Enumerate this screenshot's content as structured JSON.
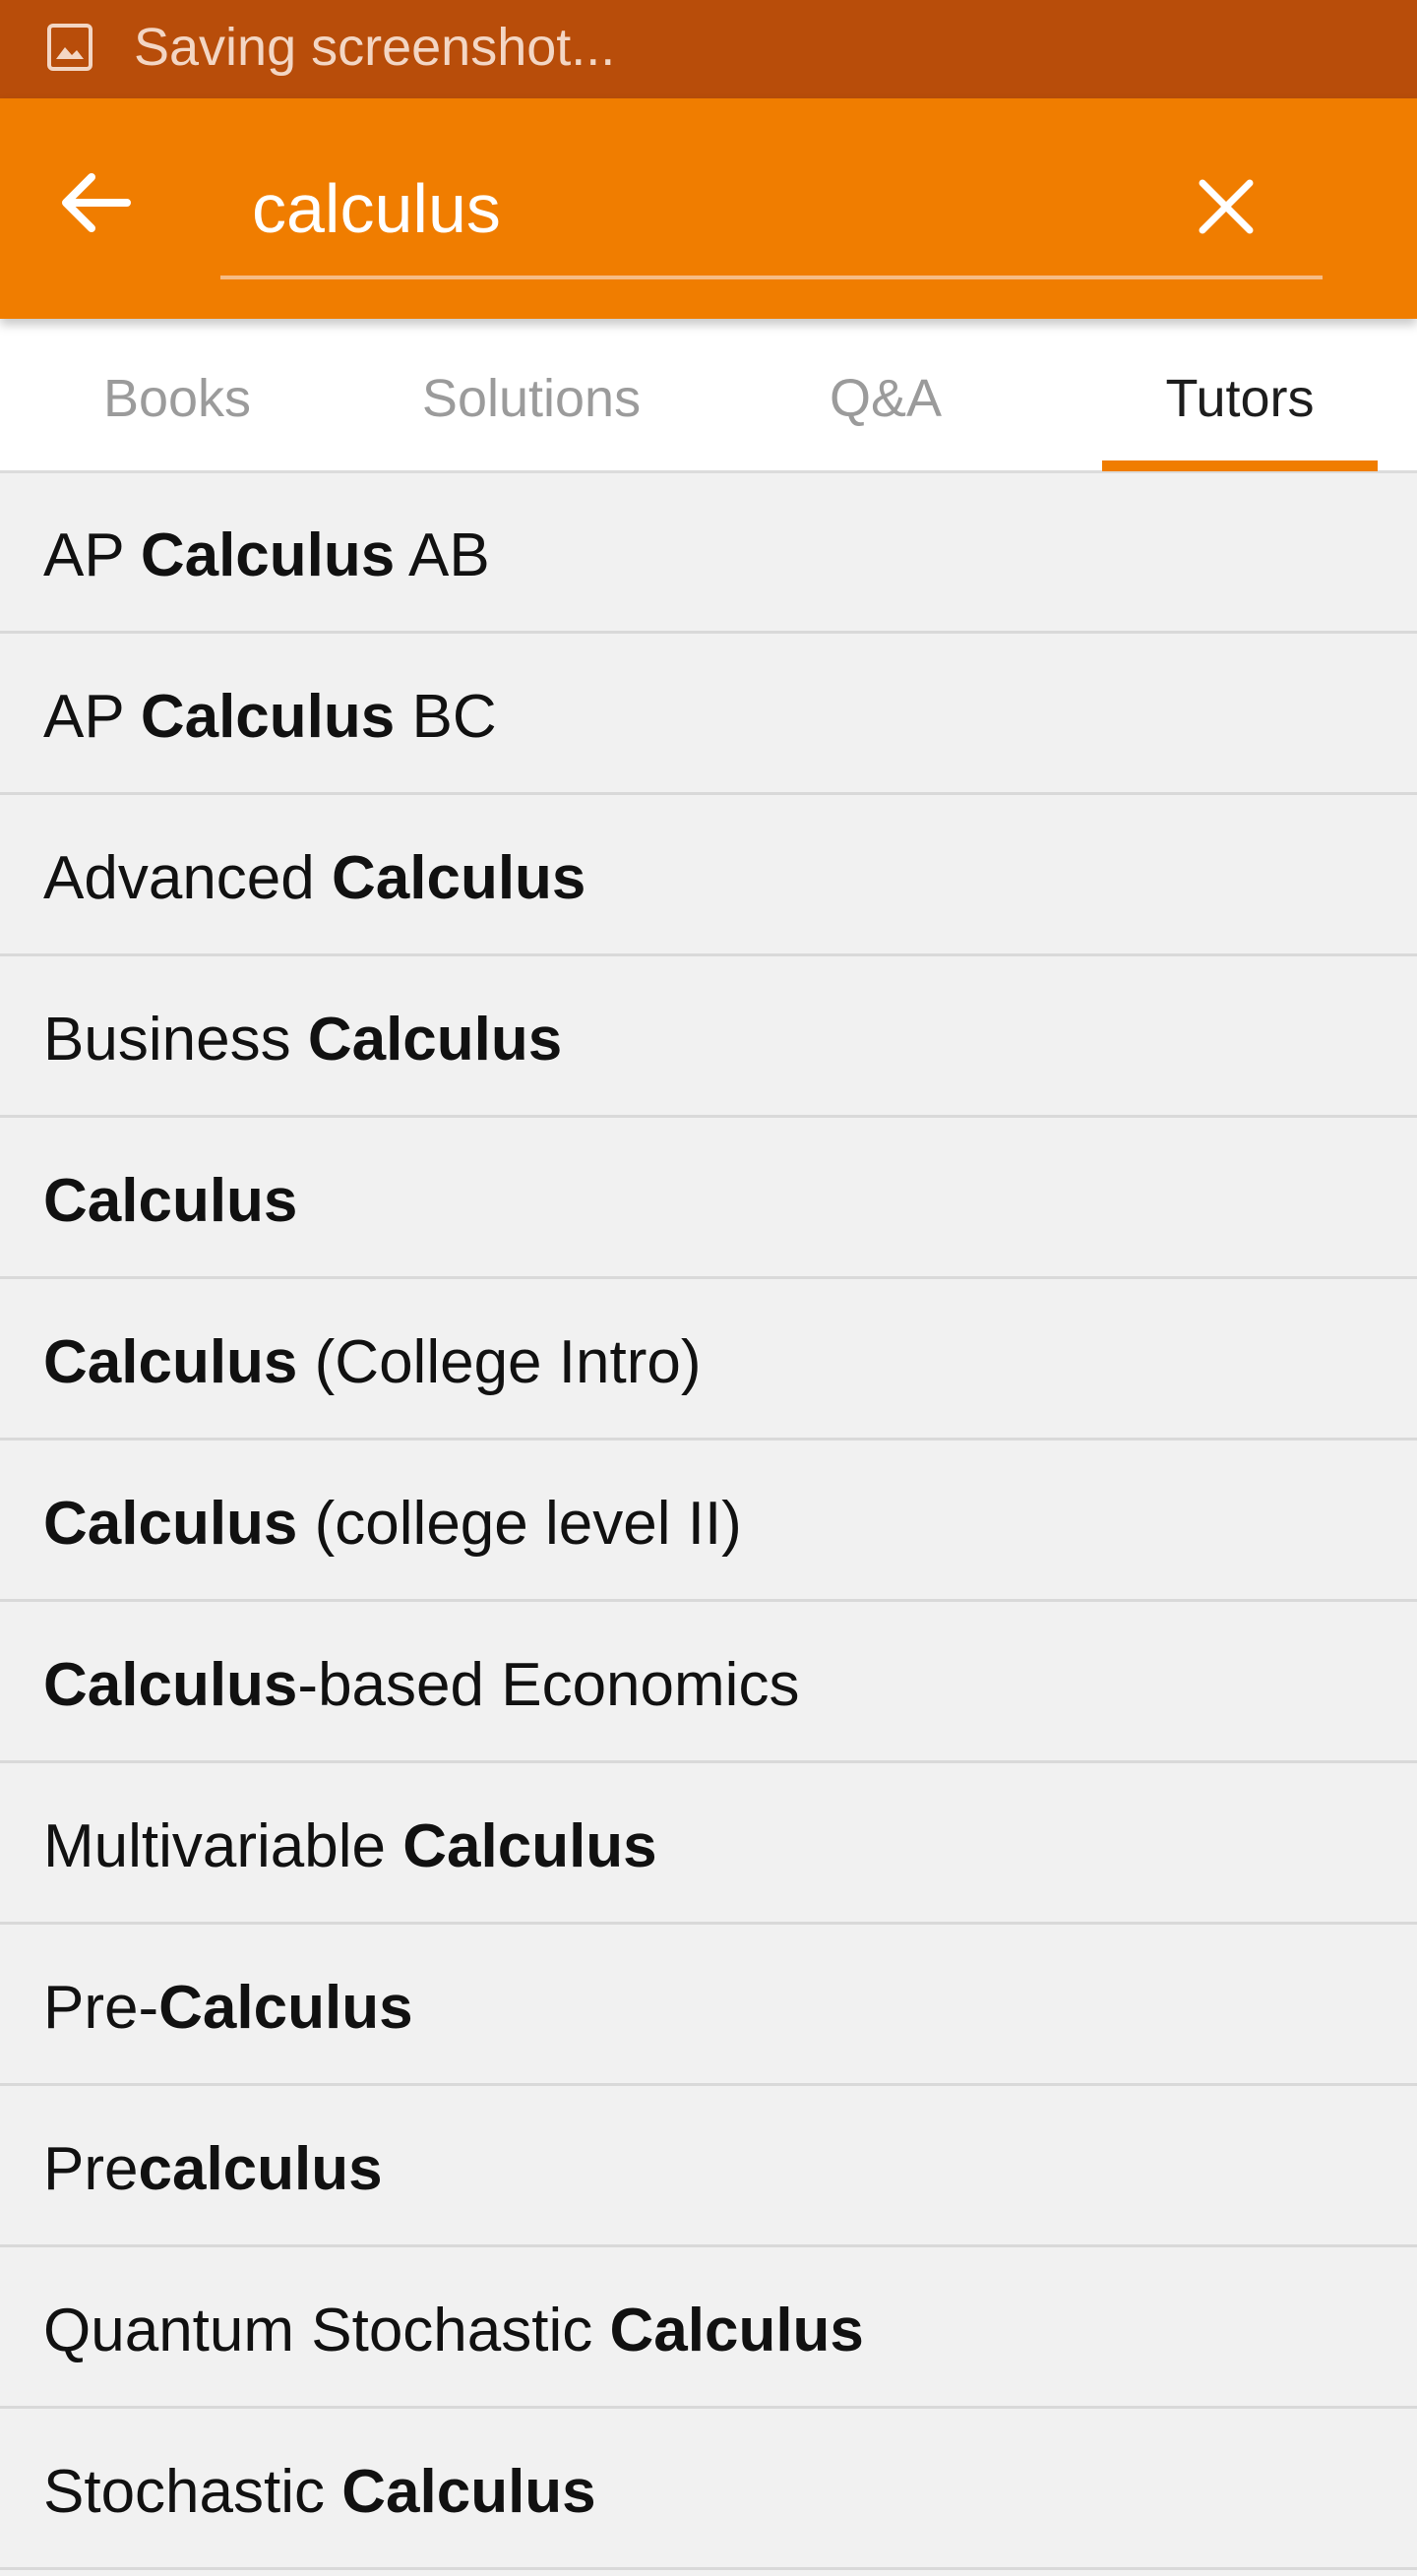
{
  "status_bar": {
    "icon": "image-icon",
    "text": "Saving screenshot..."
  },
  "app_bar": {
    "back_icon": "arrow-left-icon",
    "clear_icon": "close-icon",
    "search_value": "calculus",
    "accent_color": "#f07d00"
  },
  "tabs": [
    {
      "label": "Books",
      "active": false
    },
    {
      "label": "Solutions",
      "active": false
    },
    {
      "label": "Q&A",
      "active": false
    },
    {
      "label": "Tutors",
      "active": true
    }
  ],
  "results": [
    {
      "parts": [
        {
          "text": "AP ",
          "bold": false
        },
        {
          "text": "Calculus",
          "bold": true
        },
        {
          "text": " AB",
          "bold": false
        }
      ]
    },
    {
      "parts": [
        {
          "text": "AP ",
          "bold": false
        },
        {
          "text": "Calculus",
          "bold": true
        },
        {
          "text": " BC",
          "bold": false
        }
      ]
    },
    {
      "parts": [
        {
          "text": "Advanced ",
          "bold": false
        },
        {
          "text": "Calculus",
          "bold": true
        }
      ]
    },
    {
      "parts": [
        {
          "text": "Business ",
          "bold": false
        },
        {
          "text": "Calculus",
          "bold": true
        }
      ]
    },
    {
      "parts": [
        {
          "text": "Calculus",
          "bold": true
        }
      ]
    },
    {
      "parts": [
        {
          "text": "Calculus",
          "bold": true
        },
        {
          "text": " (College Intro)",
          "bold": false
        }
      ]
    },
    {
      "parts": [
        {
          "text": "Calculus",
          "bold": true
        },
        {
          "text": " (college level II)",
          "bold": false
        }
      ]
    },
    {
      "parts": [
        {
          "text": "Calculus",
          "bold": true
        },
        {
          "text": "-based Economics",
          "bold": false
        }
      ]
    },
    {
      "parts": [
        {
          "text": "Multivariable ",
          "bold": false
        },
        {
          "text": "Calculus",
          "bold": true
        }
      ]
    },
    {
      "parts": [
        {
          "text": "Pre-",
          "bold": false
        },
        {
          "text": "Calculus",
          "bold": true
        }
      ]
    },
    {
      "parts": [
        {
          "text": "Pre",
          "bold": false
        },
        {
          "text": "calculus",
          "bold": true
        }
      ]
    },
    {
      "parts": [
        {
          "text": "Quantum Stochastic ",
          "bold": false
        },
        {
          "text": "Calculus",
          "bold": true
        }
      ]
    },
    {
      "parts": [
        {
          "text": "Stochastic ",
          "bold": false
        },
        {
          "text": "Calculus",
          "bold": true
        }
      ]
    }
  ]
}
